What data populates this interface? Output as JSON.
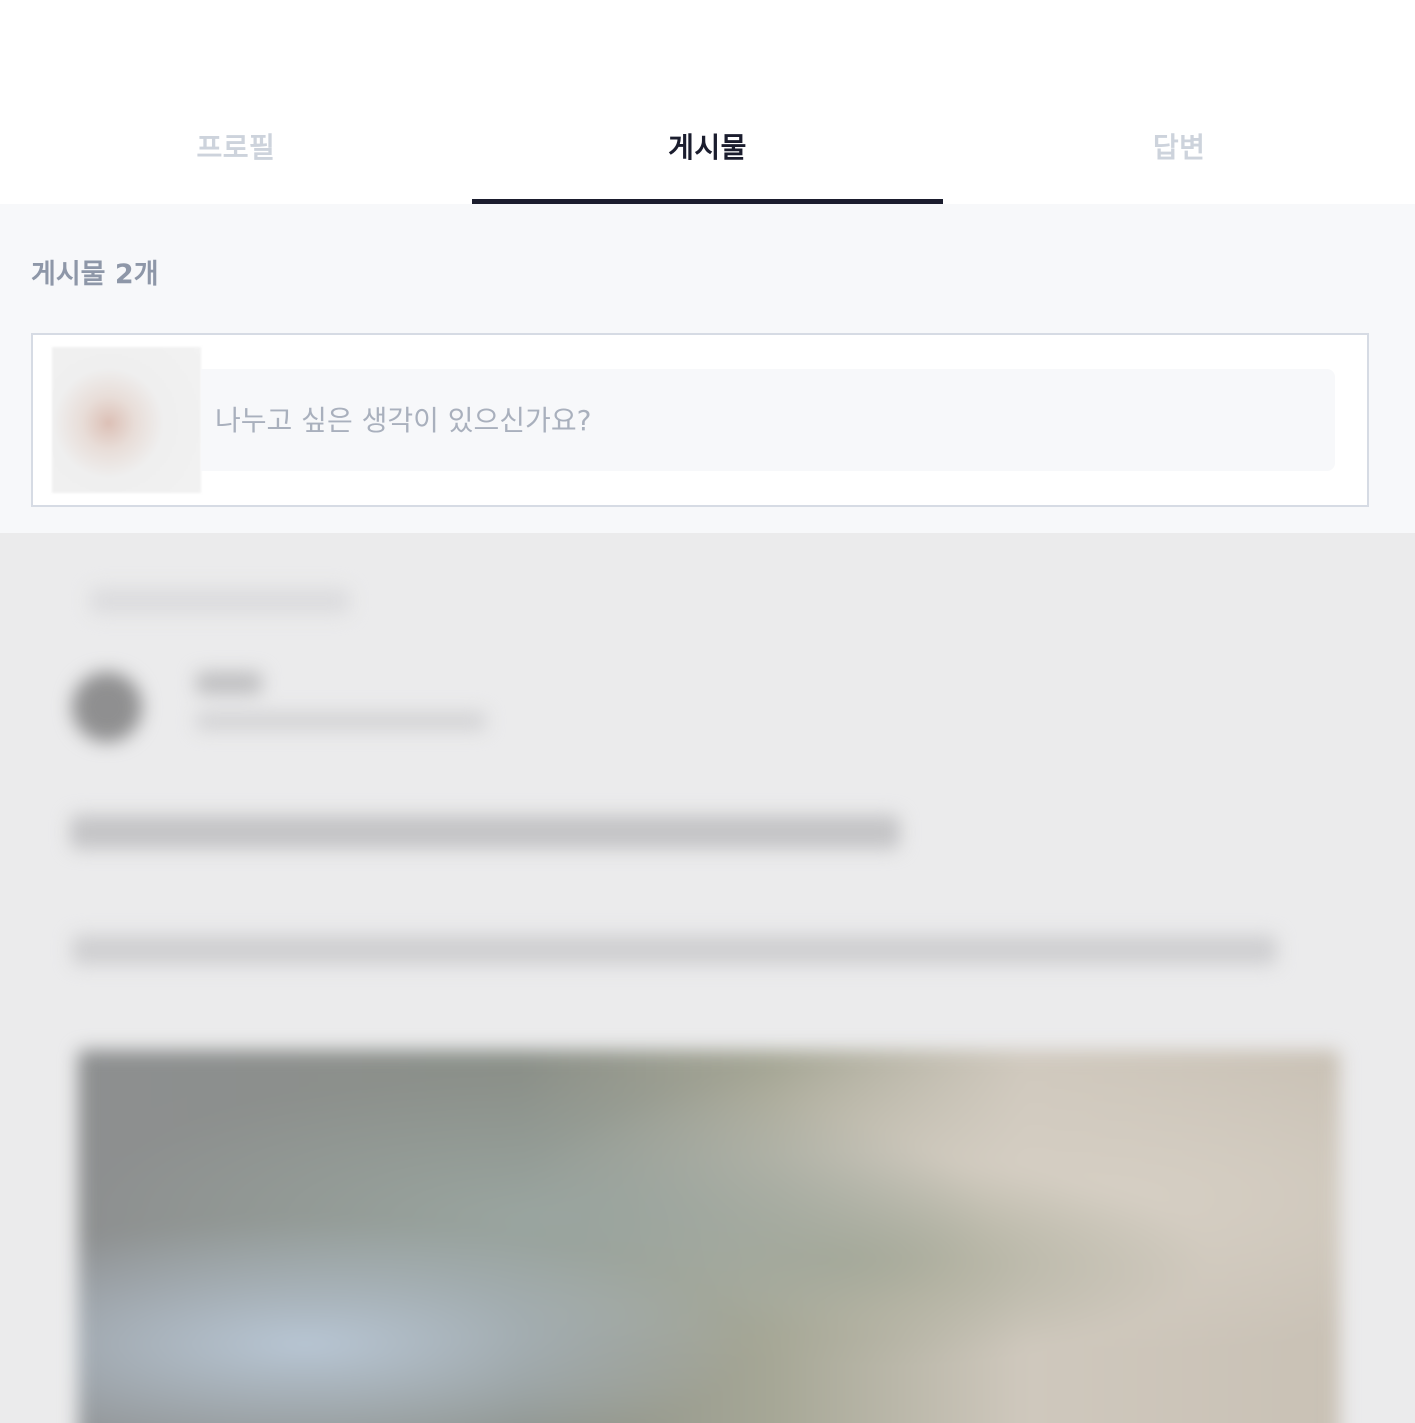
{
  "tabs": [
    {
      "label": "프로필",
      "active": false
    },
    {
      "label": "게시물",
      "active": true
    },
    {
      "label": "답변",
      "active": false
    }
  ],
  "posts": {
    "count_label": "게시물 2개"
  },
  "composer": {
    "placeholder": "나누고 싶은 생각이 있으신가요?"
  },
  "colors": {
    "active_tab": "#1b1d2e",
    "inactive_tab": "#cdd3dc",
    "count_text": "#8e97a8",
    "placeholder": "#a9b0bd",
    "area_background": "#f7f8fa"
  }
}
